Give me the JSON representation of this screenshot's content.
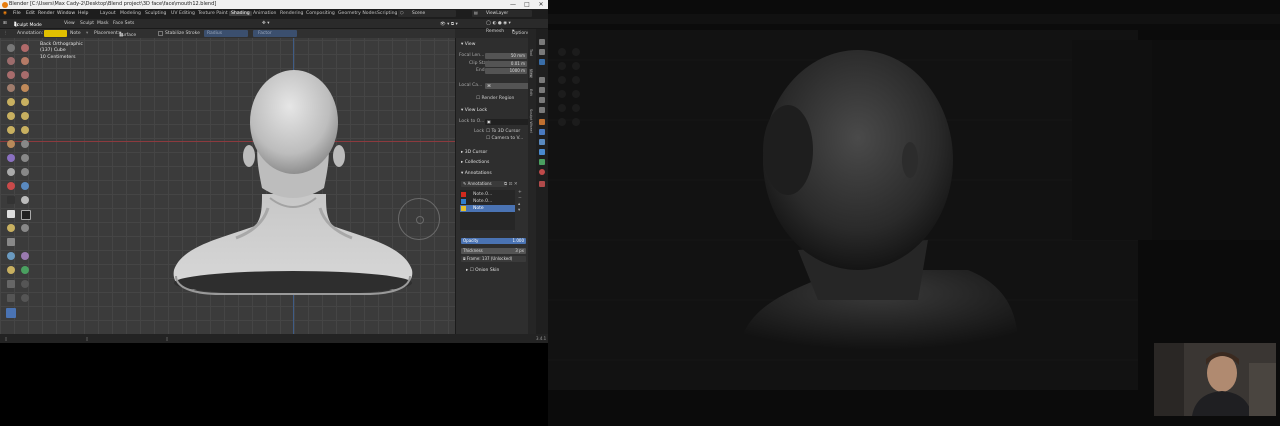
{
  "titlebar": {
    "title": "Blender [C:\\Users\\Max Cady-2\\Desktop\\Blend project\\3D face\\face\\mouth12.blend]",
    "minimize": "—",
    "maximize": "□",
    "close": "✕"
  },
  "menu": {
    "items": [
      "File",
      "Edit",
      "Render",
      "Window",
      "Help"
    ],
    "tabs": [
      "Layout",
      "Modeling",
      "Sculpting",
      "UV Editing",
      "Texture Paint",
      "Shading",
      "Animation",
      "Rendering",
      "Compositing",
      "Geometry Nodes",
      "Scripting"
    ],
    "active_tab": "Shading",
    "scene": "Scene",
    "view_layer": "ViewLayer"
  },
  "header": {
    "mode": "Sculpt Mode",
    "view": "View",
    "sculpt": "Sculpt",
    "mask": "Mask",
    "face_sets": "Face Sets",
    "remesh": "Remesh",
    "options": "Options"
  },
  "tool_header": {
    "annotation_label": "Annotation:",
    "note": "Note",
    "placement_label": "Placement:",
    "placement_value": "Surface",
    "stabilize": "Stabilize Stroke",
    "radius": "Radius",
    "factor": "Factor",
    "accent": "#e1c000"
  },
  "viewport": {
    "view_name": "Back Orthographic",
    "object": "(137) Cube",
    "scale": "10 Centimeters"
  },
  "npanel": {
    "view_header": "View",
    "focal_label": "Focal Len...",
    "focal_value": "50 mm",
    "clip_start_label": "Clip Start",
    "clip_start_value": "0.01 m",
    "clip_end_label": "End",
    "clip_end_value": "1000 m",
    "local_camera_label": "Local Ca...",
    "render_region": "Render Region",
    "view_lock_header": "View Lock",
    "lock_to_label": "Lock to O...",
    "lock_label": "Lock",
    "to_3d_cursor": "To 3D Cursor",
    "camera_to_view": "Camera to V...",
    "cursor_header": "3D Cursor",
    "collections_header": "Collections",
    "annotations_header": "Annotations",
    "annotations_name": "Annotations",
    "layers": [
      {
        "name": "Note.0...",
        "color": "#d12a1e"
      },
      {
        "name": "Note.0...",
        "color": "#2f7fd0"
      },
      {
        "name": "Note",
        "color": "#e6c12a"
      }
    ],
    "opacity_label": "Opacity",
    "opacity_value": "1.000",
    "thickness_label": "Thickness",
    "thickness_value": "3 px",
    "frame_label": "Frame: 137 (Unlocked)",
    "onion_label": "Onion Skin"
  },
  "vtabs": [
    "Tool",
    "View",
    "Edit",
    "Sculpt Wheel"
  ],
  "status": {
    "right": "3.4.1"
  },
  "colors": {
    "viewport_bg": "#3b3b3b",
    "x_axis": "#8c3a3e",
    "z_axis": "#3f5c86",
    "active_button": "#4a73b3"
  }
}
